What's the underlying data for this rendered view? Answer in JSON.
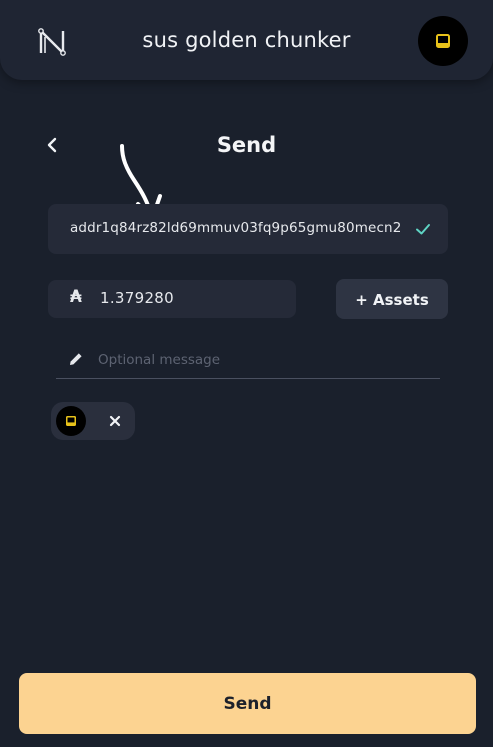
{
  "header": {
    "wallet_name": "sus golden chunker",
    "logo_icon": "nami-logo-icon",
    "avatar_icon": "nft-avatar-icon"
  },
  "page": {
    "title": "Send",
    "back_icon": "chevron-left-icon"
  },
  "recipient": {
    "address": "addr1q84rz82ld69mmuv03fq9p65gmu80mecn2",
    "valid_icon": "check-icon",
    "valid_color": "#5fd4c4"
  },
  "amount": {
    "currency_symbol": "₳",
    "value": "1.379280"
  },
  "assets_button": {
    "label": "+ Assets"
  },
  "message": {
    "placeholder": "Optional message",
    "value": "",
    "icon": "pencil-icon"
  },
  "selected_assets": [
    {
      "icon": "nft-asset-icon",
      "remove_icon": "close-icon"
    }
  ],
  "send_button": {
    "label": "Send",
    "color": "#fcd391"
  },
  "colors": {
    "background": "#1a202c",
    "header": "#1f2533",
    "field": "#252a38",
    "nft_accent": "#e8c21a"
  }
}
